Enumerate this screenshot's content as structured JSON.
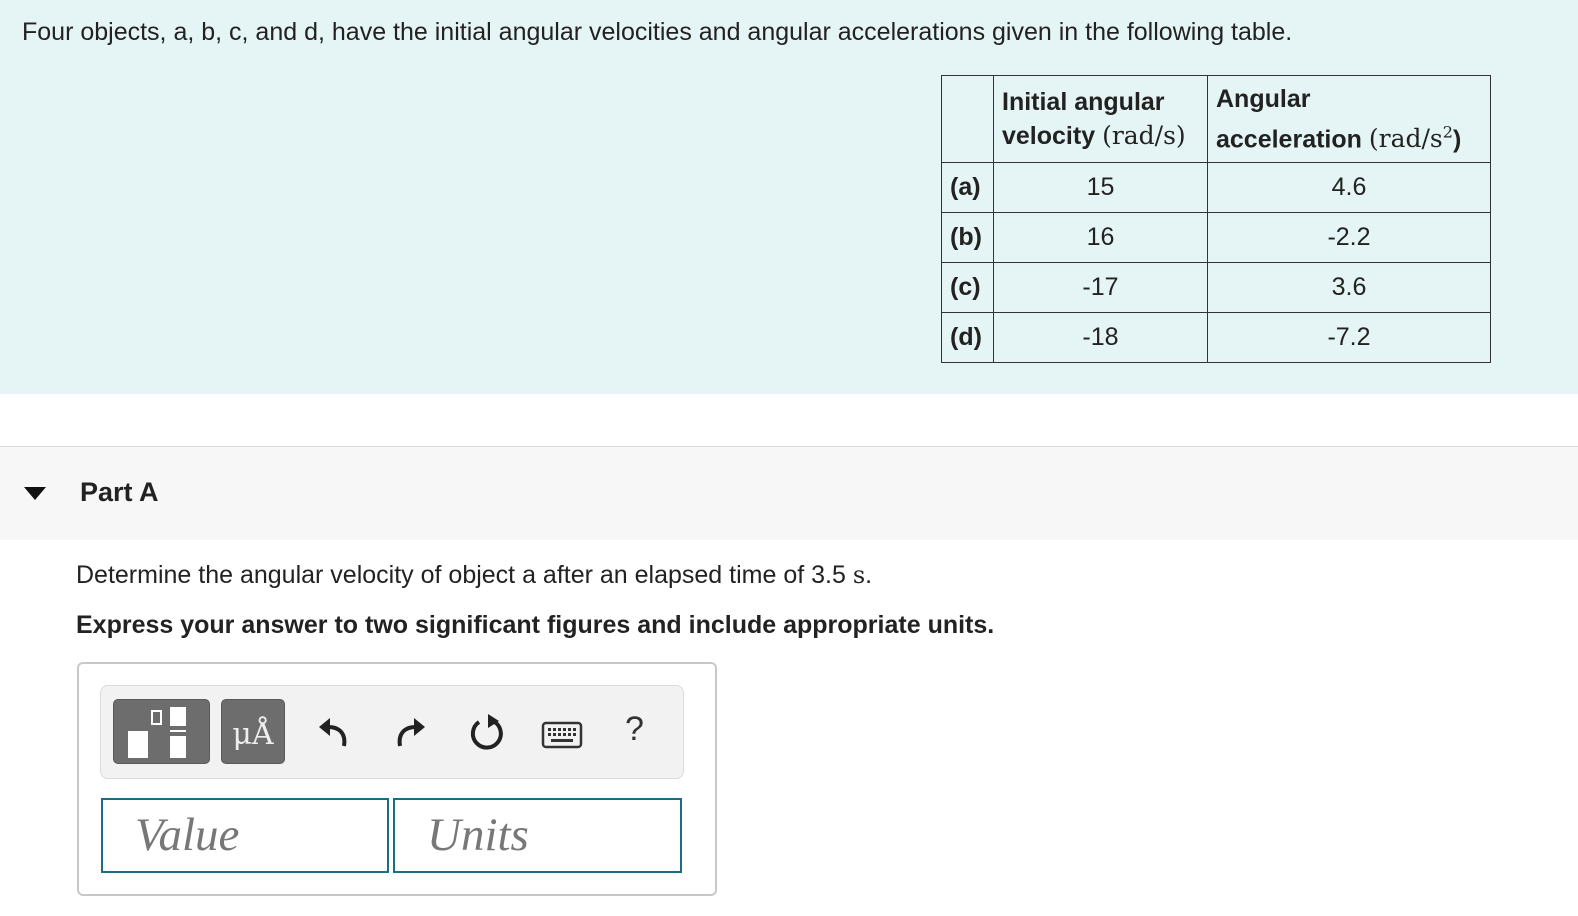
{
  "problem": {
    "intro": "Four objects, a, b, c, and d, have the initial angular velocities and angular accelerations given in the following table.",
    "table": {
      "col1_header_line1": "Initial angular",
      "col1_header_word": "velocity",
      "col1_header_unit": "(rad/s)",
      "col2_header_line1": "Angular",
      "col2_header_word": "acceleration",
      "col2_header_unit_pre": "(rad/s",
      "col2_header_unit_exp": "2",
      "col2_header_unit_post": ")",
      "rows": [
        {
          "label": "(a)",
          "velocity": "15",
          "acceleration": "4.6"
        },
        {
          "label": "(b)",
          "velocity": "16",
          "acceleration": "-2.2"
        },
        {
          "label": "(c)",
          "velocity": "-17",
          "acceleration": "3.6"
        },
        {
          "label": "(d)",
          "velocity": "-18",
          "acceleration": "-7.2"
        }
      ]
    }
  },
  "part": {
    "title": "Part A",
    "question_pre": "Determine the angular velocity of object a after an elapsed time of 3.5 ",
    "question_unit": "s",
    "question_post": ".",
    "instructions": "Express your answer to two significant figures and include appropriate units."
  },
  "toolbar": {
    "units_label": "μÅ",
    "help_label": "?",
    "icons": [
      "templates-icon",
      "units-icon",
      "undo-icon",
      "redo-icon",
      "reset-icon",
      "keyboard-icon",
      "help-icon"
    ]
  },
  "answer": {
    "value_placeholder": "Value",
    "units_placeholder": "Units"
  },
  "colors": {
    "intro_bg": "#e5f5f5",
    "field_border": "#1d6c86",
    "button_dark": "#6d6d6d"
  }
}
